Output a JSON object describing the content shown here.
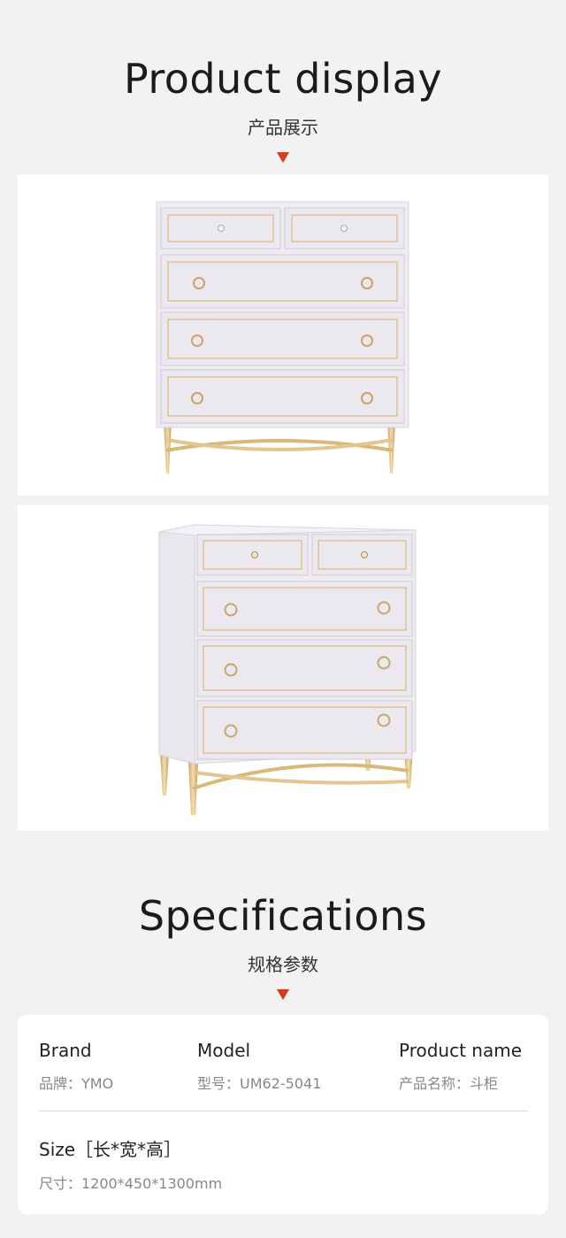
{
  "product_display": {
    "title": "Product display",
    "subtitle": "产品展示"
  },
  "images": [
    {
      "name": "product-image-front",
      "view": "front view, white five-drawer chest with gold legs"
    },
    {
      "name": "product-image-angle",
      "view": "angled view, white five-drawer chest with gold legs"
    }
  ],
  "specifications": {
    "title": "Specifications",
    "subtitle": "规格参数",
    "brand": {
      "heading": "Brand",
      "value": "品牌：YMO"
    },
    "model": {
      "heading": "Model",
      "value": "型号：UM62-5041"
    },
    "product_name": {
      "heading": "Product name",
      "value": "产品名称：斗柜"
    },
    "size": {
      "heading": "Size［长*宽*高］",
      "value": "尺寸：1200*450*1300mm"
    }
  },
  "colors": {
    "background": "#f2f2f2",
    "accent_arrow": "#d63a20",
    "cabinet_white": "#efedf2",
    "brass": "#d9b87a"
  }
}
